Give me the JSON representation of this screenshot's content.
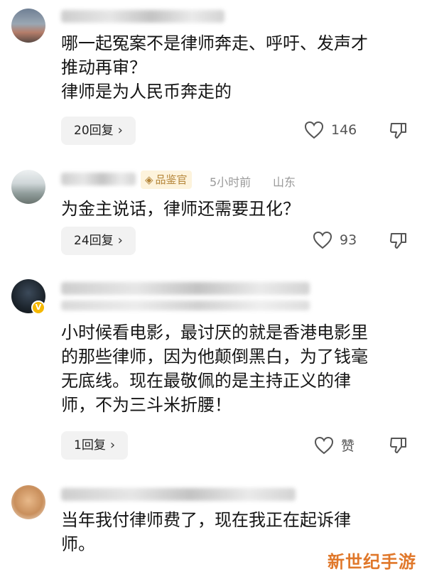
{
  "comments": [
    {
      "text": "哪一起冤案不是律师奔走、呼吁、发声才\n推动再审？\n律师是为人民币奔走的",
      "replies": "20回复",
      "likes": "146"
    },
    {
      "badge": "品鉴官",
      "time": "5小时前",
      "location": "山东",
      "text": "为金主说话，律师还需要丑化？",
      "replies": "24回复",
      "likes": "93"
    },
    {
      "text": "小时候看电影，最讨厌的就是香港电影里\n的那些律师，因为他颠倒黑白，为了钱毫\n无底线。现在最敬佩的是主持正义的律\n师，不为三斗米折腰！",
      "replies": "1回复",
      "likes": "赞"
    },
    {
      "text": "当年我付律师费了，现在我正在起诉律\n师。"
    }
  ],
  "watermark": "新世纪手游",
  "icons": {
    "like": "heart-outline-icon",
    "dislike": "thumbs-down-outline-icon",
    "chevron": "chevron-right-icon",
    "verified": "verified-v-badge-icon"
  },
  "colors": {
    "reply_bg": "#f2f2f2",
    "badge_bg": "#fdf3dc",
    "badge_text": "#b5863a",
    "watermark": "#e0782b"
  }
}
